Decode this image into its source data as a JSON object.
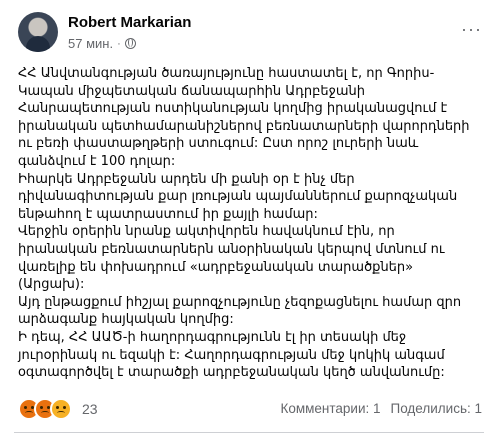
{
  "post": {
    "author": "Robert Markarian",
    "time": "57 мин.",
    "separator": "·",
    "paragraphs": [
      "ՀՀ Անվտանգության ծառայությունը հաստատել է, որ Գորիս-Կապան միջպետական ճանապարհին Ադրբեջանի Հանրապետության ոստիկանության կողմից իրականացվում է իրանական պետհամարանիշներով բեռնատարների վարորդների ու բեռի փաստաթղթերի ստուգում: Ըստ որոշ լուրերի նաև գանձվում է 100 դոլար:",
      "Իհարկե Ադրբեջանն արդեն մի քանի օր է ինչ մեր դիվանագիտության քար լռության պայմաններում քարոզչական ենթահող է պատրաստում իր քայլի համար:",
      "Վերջին օրերին նրանք ակտիվորեն հավակնում էին, որ իրանական բեռնատարներն անօրինական կերպով մտնում ու վառելիք են փոխադրում «ադրբեջանական տարածքներ» (Արցախ):",
      "Այդ ընթացքում իհշյալ քարոզչությունը չեզոքացնելու համար զրո արձագանք հայկական կողմից:",
      "Ի դեպ, ՀՀ ԱԱԾ-ի հաղորդագրությունն էլ իր տեսակի մեջ յուրօրինակ ու եզակի է: Հաղորդագրության մեջ կոկիկ անգամ օգտագործվել է տարածքի ադրբեջանական կեղծ անվանումը:"
    ]
  },
  "reactions": {
    "types": [
      "angry",
      "sad"
    ],
    "count": "23"
  },
  "stats": {
    "comments": "Комментарии: 1",
    "shares": "Поделились: 1"
  }
}
